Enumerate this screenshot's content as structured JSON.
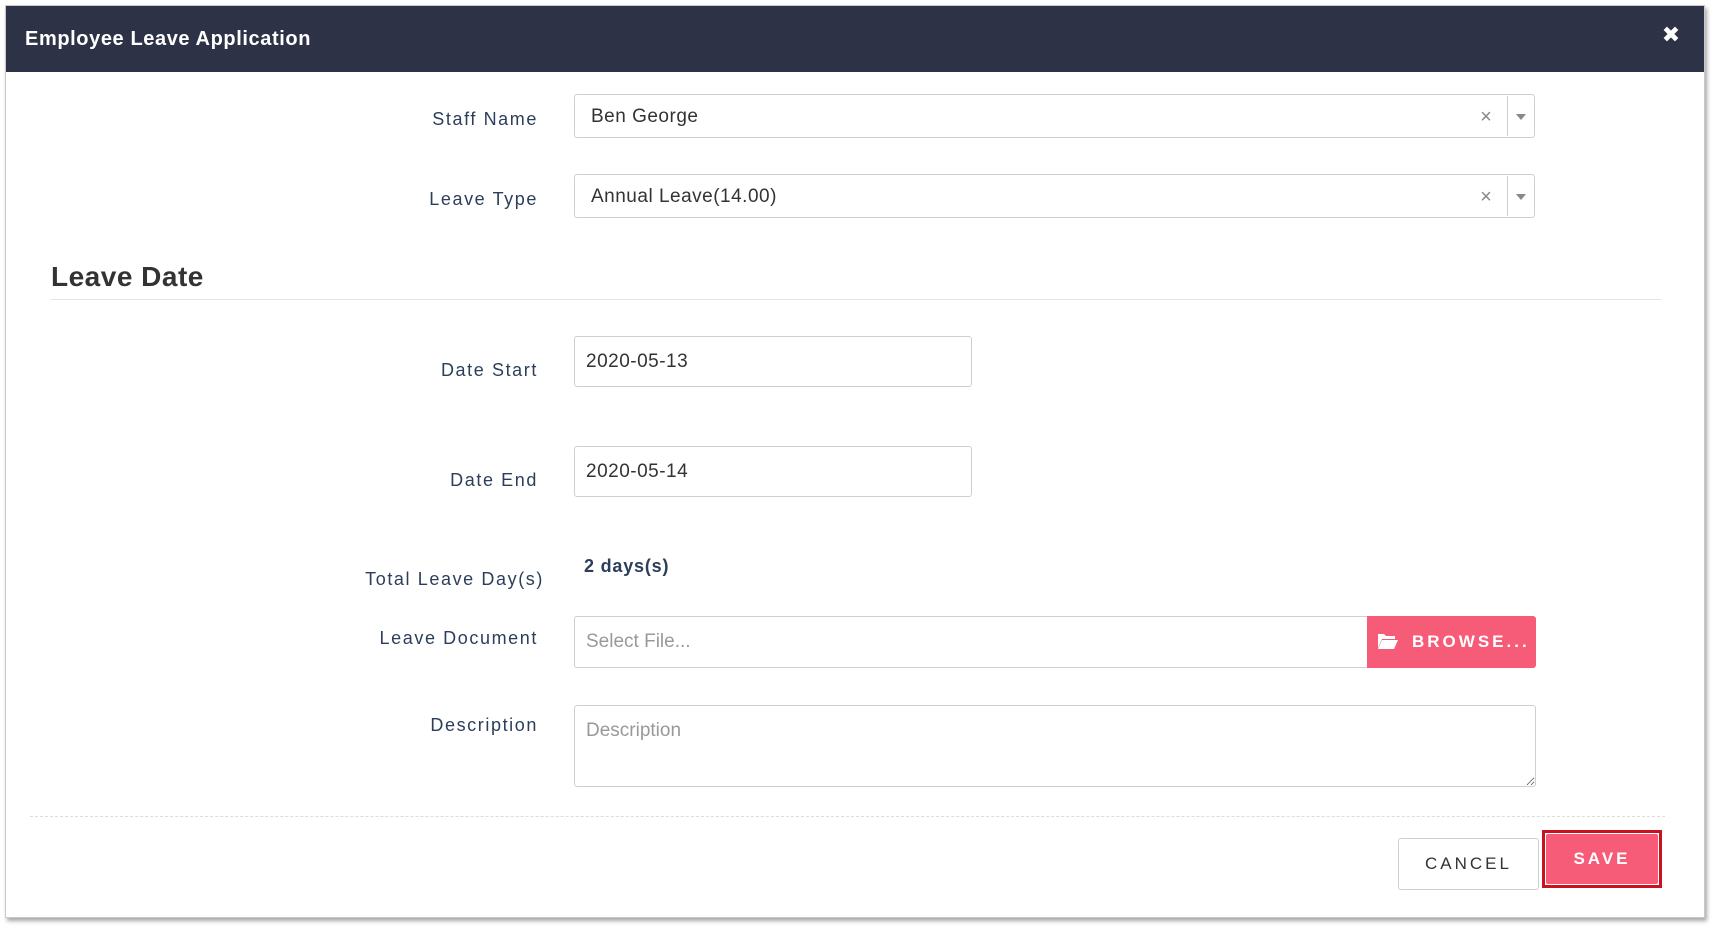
{
  "dialog": {
    "title": "Employee Leave Application"
  },
  "form": {
    "staff_name": {
      "label": "Staff Name",
      "value": "Ben George"
    },
    "leave_type": {
      "label": "Leave Type",
      "value": "Annual Leave(14.00)"
    },
    "section_title": "Leave Date",
    "date_start": {
      "label": "Date Start",
      "value": "2020-05-13"
    },
    "date_end": {
      "label": "Date End",
      "value": "2020-05-14"
    },
    "total_days": {
      "label": "Total Leave Day(s)",
      "value": "2 days(s)"
    },
    "leave_document": {
      "label": "Leave Document",
      "placeholder": "Select File...",
      "browse_label": "BROWSE..."
    },
    "description": {
      "label": "Description",
      "placeholder": "Description"
    }
  },
  "footer": {
    "cancel_label": "CANCEL",
    "save_label": "SAVE"
  },
  "colors": {
    "header_bg": "#2d3246",
    "accent": "#f65b78",
    "highlight_border": "#c8121e",
    "label_text": "#2c3e5a"
  },
  "icons": {
    "close": "close-icon",
    "clear": "clear-icon",
    "dropdown": "chevron-down-icon",
    "folder": "folder-open-icon"
  }
}
